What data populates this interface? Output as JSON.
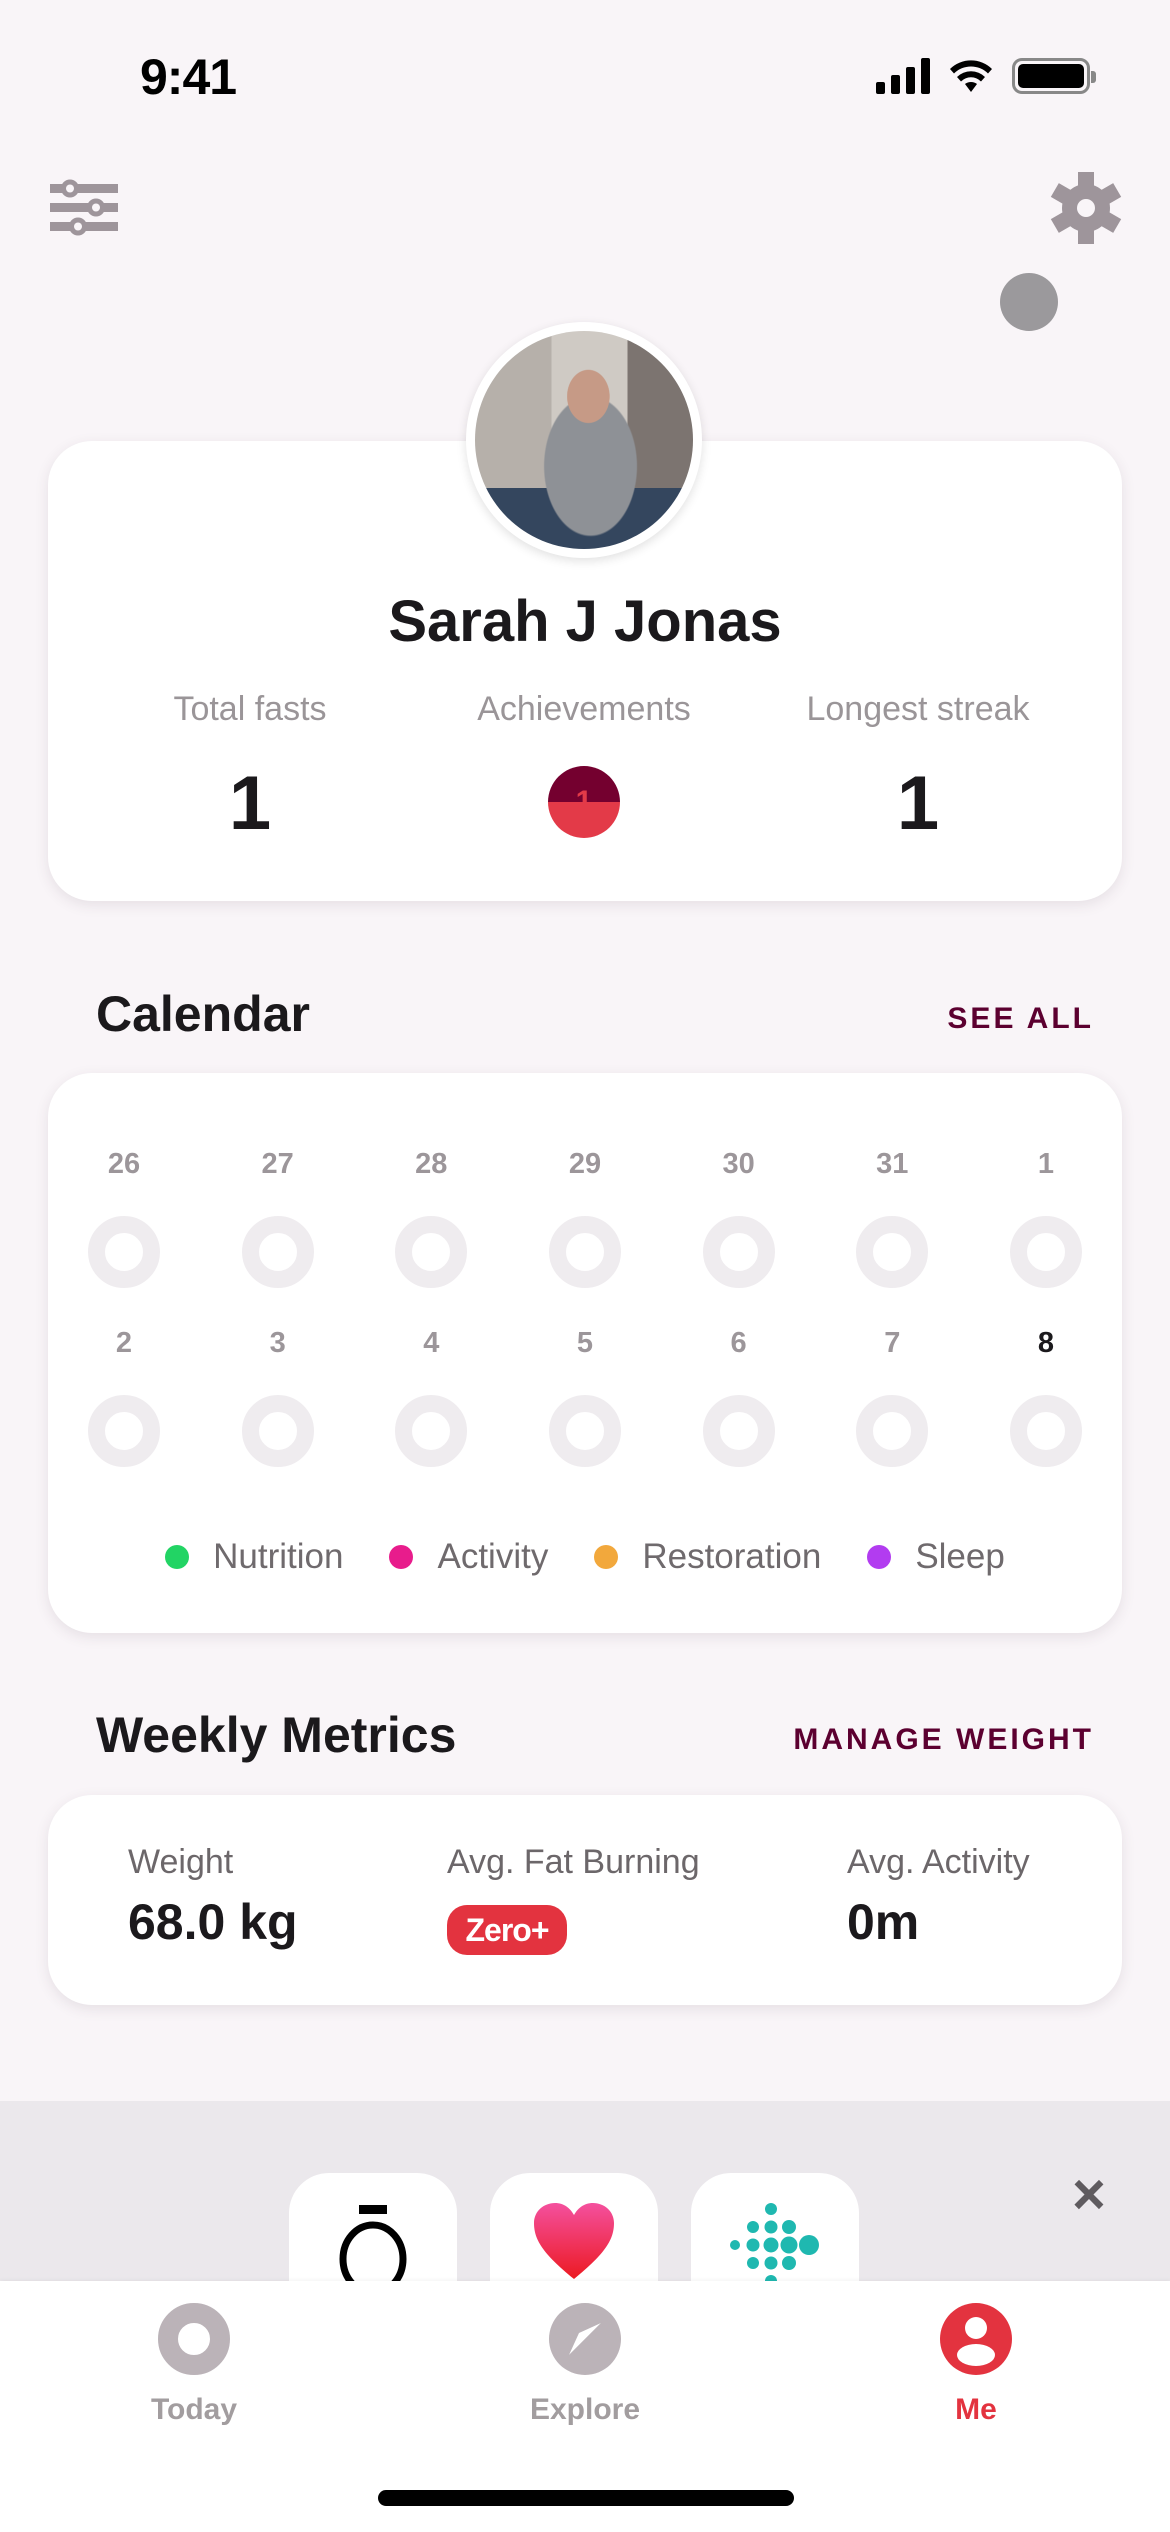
{
  "status_bar": {
    "time": "9:41"
  },
  "header": {
    "filter_icon": "sliders-icon",
    "settings_icon": "gear-icon"
  },
  "profile": {
    "name": "Sarah J Jonas",
    "stats": [
      {
        "label": "Total fasts",
        "value": "1"
      },
      {
        "label": "Achievements",
        "value": "1"
      },
      {
        "label": "Longest streak",
        "value": "1"
      }
    ]
  },
  "calendar": {
    "title": "Calendar",
    "see_all": "SEE ALL",
    "week1": [
      "26",
      "27",
      "28",
      "29",
      "30",
      "31",
      "1"
    ],
    "week2": [
      "2",
      "3",
      "4",
      "5",
      "6",
      "7",
      "8"
    ],
    "today": "8",
    "legend": [
      {
        "label": "Nutrition",
        "color": "#22d464"
      },
      {
        "label": "Activity",
        "color": "#e81c8c"
      },
      {
        "label": "Restoration",
        "color": "#f2a83c"
      },
      {
        "label": "Sleep",
        "color": "#b23cf0"
      }
    ]
  },
  "weekly_metrics": {
    "title": "Weekly Metrics",
    "manage_weight": "MANAGE WEIGHT",
    "weight_label": "Weight",
    "weight_value": "68.0 kg",
    "fat_label": "Avg. Fat Burning",
    "fat_badge": "Zero+",
    "activity_label": "Avg. Activity",
    "activity_value": "0m"
  },
  "integrations": {
    "apps": [
      "oura-icon",
      "apple-health-icon",
      "fitbit-icon"
    ],
    "close": "×"
  },
  "nav": {
    "items": [
      {
        "label": "Today",
        "icon": "today-ring-icon",
        "active": false
      },
      {
        "label": "Explore",
        "icon": "compass-icon",
        "active": false
      },
      {
        "label": "Me",
        "icon": "profile-icon",
        "active": true
      }
    ]
  },
  "colors": {
    "accent": "#e3333f",
    "link": "#5c0030",
    "background": "#f9f5f8"
  }
}
